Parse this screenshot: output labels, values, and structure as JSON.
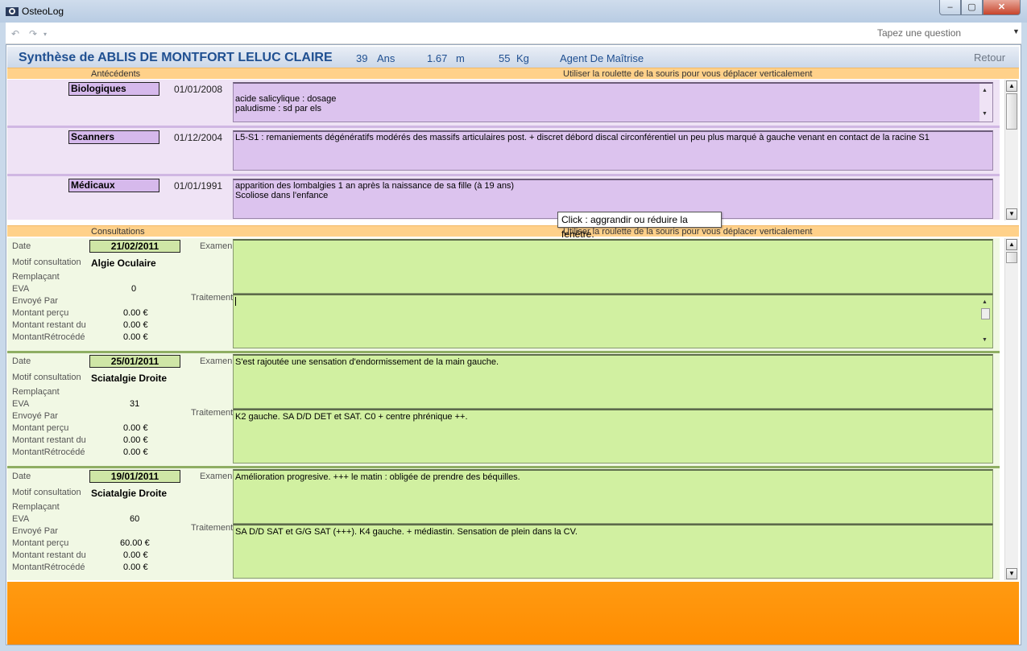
{
  "window": {
    "title": "OsteoLog",
    "min": "–",
    "max": "▢",
    "close": "✕"
  },
  "toolbar": {
    "undo": "↶",
    "redo": "↷",
    "ask_placeholder": "Tapez une question",
    "ask_arrow": "▼"
  },
  "header": {
    "title": "Synthèse de ABLIS DE MONTFORT LELUC CLAIRE",
    "age": "39",
    "age_unit": "Ans",
    "height": "1.67",
    "height_unit": "m",
    "weight": "55",
    "weight_unit": "Kg",
    "profession": "Agent De Maîtrise",
    "retour": "Retour"
  },
  "antecedents": {
    "section_label": "Antécédents",
    "hint": "Utiliser la roulette de la souris pour vous déplacer verticalement",
    "items": [
      {
        "category": "Biologiques",
        "date": "01/01/2008",
        "text": "acide salicylique : dosage\npaludisme : sd par els"
      },
      {
        "category": "Scanners",
        "date": "01/12/2004",
        "text": "L5-S1 : remaniements dégénératifs modérés des massifs articulaires post. + discret débord discal circonférentiel un peu plus marqué à gauche venant en contact de la racine S1"
      },
      {
        "category": "Médicaux",
        "date": "01/01/1991",
        "text": "apparition des lombalgies 1 an après la naissance de sa fille (à 19 ans)\nScoliose dans l'enfance"
      }
    ]
  },
  "consultations": {
    "section_label": "Consultations",
    "hint": "Utiliser la roulette de la souris pour vous déplacer verticalement",
    "labels": {
      "date": "Date",
      "motif": "Motif consultation",
      "remplacant": "Remplaçant",
      "eva": "EVA",
      "envoye": "Envoyé Par",
      "percu": "Montant perçu",
      "restant": "Montant restant du",
      "retrocede": "MontantRétrocédé",
      "examen": "Examen",
      "traitement": "Traitement"
    },
    "items": [
      {
        "date": "21/02/2011",
        "motif": "Algie Oculaire",
        "eva": "0",
        "percu": "0.00 €",
        "restant": "0.00 €",
        "retrocede": "0.00 €",
        "examen": "",
        "traitement": ""
      },
      {
        "date": "25/01/2011",
        "motif": "Sciatalgie Droite",
        "eva": "31",
        "percu": "0.00 €",
        "restant": "0.00 €",
        "retrocede": "0.00 €",
        "examen": "S'est rajoutée une sensation d'endormissement de la main gauche.",
        "traitement": "K2 gauche. SA D/D DET et SAT. C0 + centre phrénique ++."
      },
      {
        "date": "19/01/2011",
        "motif": "Sciatalgie Droite",
        "eva": "60",
        "percu": "60.00 €",
        "restant": "0.00 €",
        "retrocede": "0.00 €",
        "examen": "Amélioration progresive. +++ le matin : obligée de prendre des béquilles.",
        "traitement": "SA D/D SAT et G/G SAT (+++). K4 gauche. + médiastin. Sensation de plein dans la CV."
      }
    ]
  },
  "tooltip": "Click : aggrandir ou réduire la fenêtre.",
  "scroll": {
    "up": "▲",
    "down": "▼"
  }
}
